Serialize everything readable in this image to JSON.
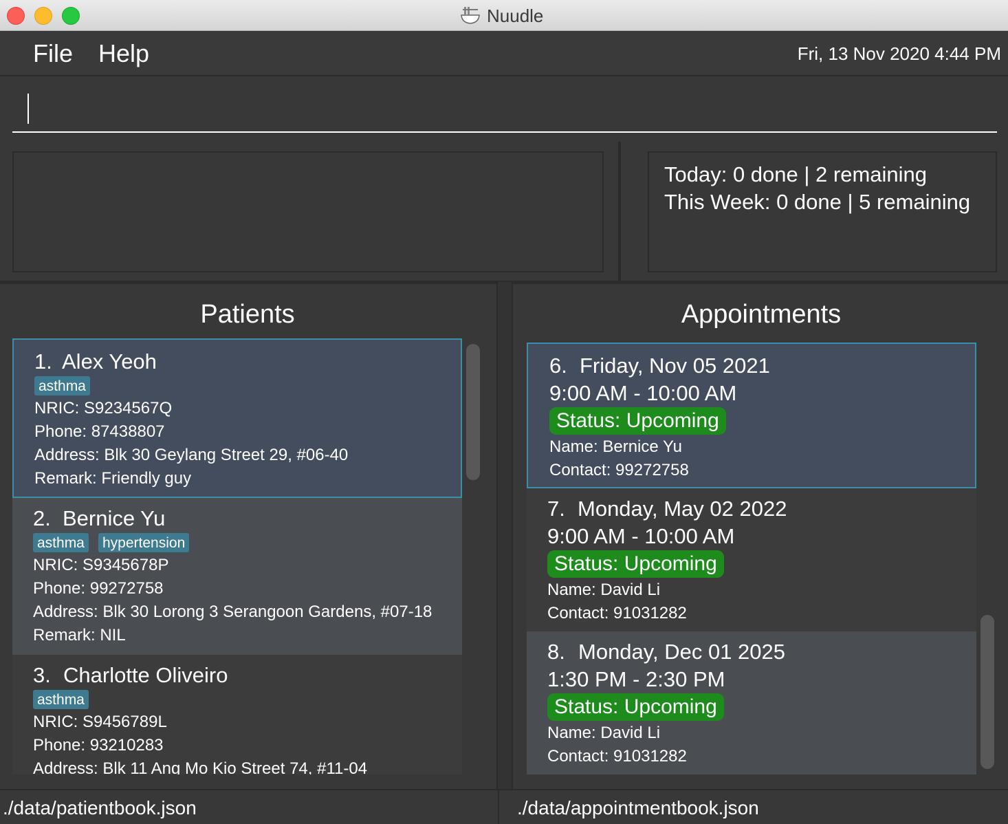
{
  "window": {
    "title": "Nuudle"
  },
  "menu": {
    "items": [
      "File",
      "Help"
    ],
    "datetime": "Fri, 13 Nov 2020 4:44 PM"
  },
  "command": {
    "value": "",
    "placeholder": ""
  },
  "stats": {
    "today": "Today: 0 done | 2 remaining",
    "week": "This Week: 0 done | 5 remaining"
  },
  "patients": {
    "title": "Patients",
    "items": [
      {
        "index": "1.",
        "name": "Alex Yeoh",
        "tags": [
          "asthma"
        ],
        "nric": "NRIC: S9234567Q",
        "phone": "Phone: 87438807",
        "address": "Address: Blk 30 Geylang Street 29, #06-40",
        "remark": "Remark: Friendly guy"
      },
      {
        "index": "2.",
        "name": "Bernice Yu",
        "tags": [
          "asthma",
          "hypertension"
        ],
        "nric": "NRIC: S9345678P",
        "phone": "Phone: 99272758",
        "address": "Address: Blk 30 Lorong 3 Serangoon Gardens, #07-18",
        "remark": "Remark: NIL"
      },
      {
        "index": "3.",
        "name": "Charlotte Oliveiro",
        "tags": [
          "asthma"
        ],
        "nric": "NRIC: S9456789L",
        "phone": "Phone: 93210283",
        "address": "Address: Blk 11 Ang Mo Kio Street 74, #11-04",
        "remark": ""
      }
    ]
  },
  "appointments": {
    "title": "Appointments",
    "items": [
      {
        "index": "6.",
        "date": "Friday, Nov 05 2021",
        "time": "9:00 AM - 10:00 AM",
        "status": "Status: Upcoming",
        "name": "Name: Bernice Yu",
        "contact": "Contact: 99272758"
      },
      {
        "index": "7.",
        "date": "Monday, May 02 2022",
        "time": "9:00 AM - 10:00 AM",
        "status": "Status: Upcoming",
        "name": "Name: David Li",
        "contact": "Contact: 91031282"
      },
      {
        "index": "8.",
        "date": "Monday, Dec 01 2025",
        "time": "1:30 PM - 2:30 PM",
        "status": "Status: Upcoming",
        "name": "Name: David Li",
        "contact": "Contact: 91031282"
      }
    ]
  },
  "footer": {
    "patient_file": "./data/patientbook.json",
    "appointment_file": "./data/appointmentbook.json"
  },
  "colors": {
    "background": "#383838",
    "selected_card": "#434d5e",
    "selected_border": "#3e8ea8",
    "alt_card": "#4a4e52",
    "dark_card": "#3c3c3c",
    "tag": "#3e7b91",
    "status": "#1d8c1d"
  },
  "icons": [
    "close-light",
    "minimize-light",
    "zoom-light",
    "noodle-bowl-icon"
  ]
}
